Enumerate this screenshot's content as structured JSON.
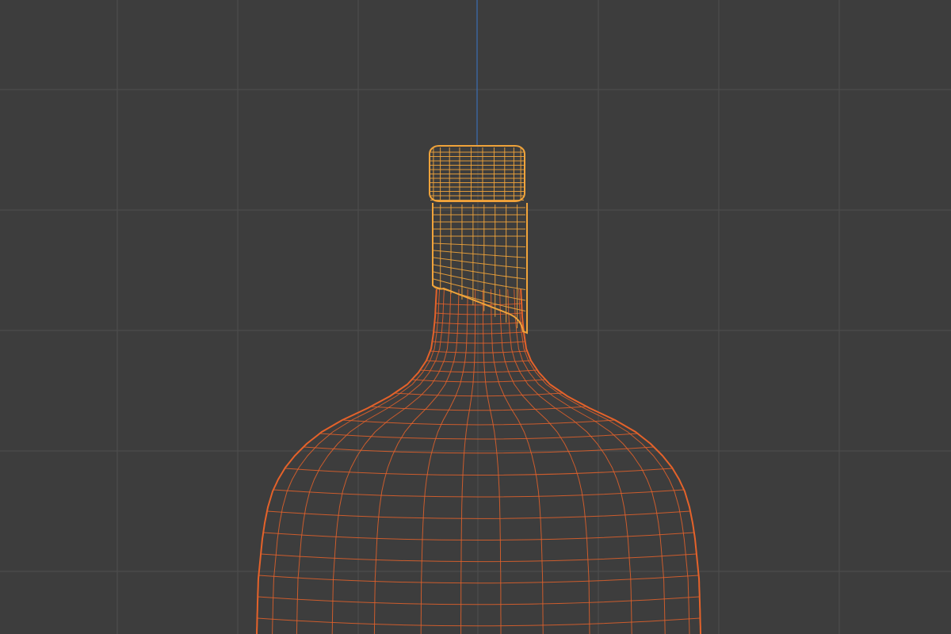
{
  "viewport": {
    "mode": "wireframe",
    "view": "front-orthographic",
    "grid": true,
    "vertical_axis": "z",
    "colors": {
      "background": "#3d3d3d",
      "grid": "#4e4e4e",
      "z_axis": "#3b6fb4",
      "active_object": "#f0a33a",
      "selected_object": "#e5622a"
    }
  },
  "objects": [
    {
      "name": "cap-foil",
      "state": "active",
      "color": "#f0a33a"
    },
    {
      "name": "bottle",
      "state": "selected",
      "color": "#e5622a"
    }
  ]
}
